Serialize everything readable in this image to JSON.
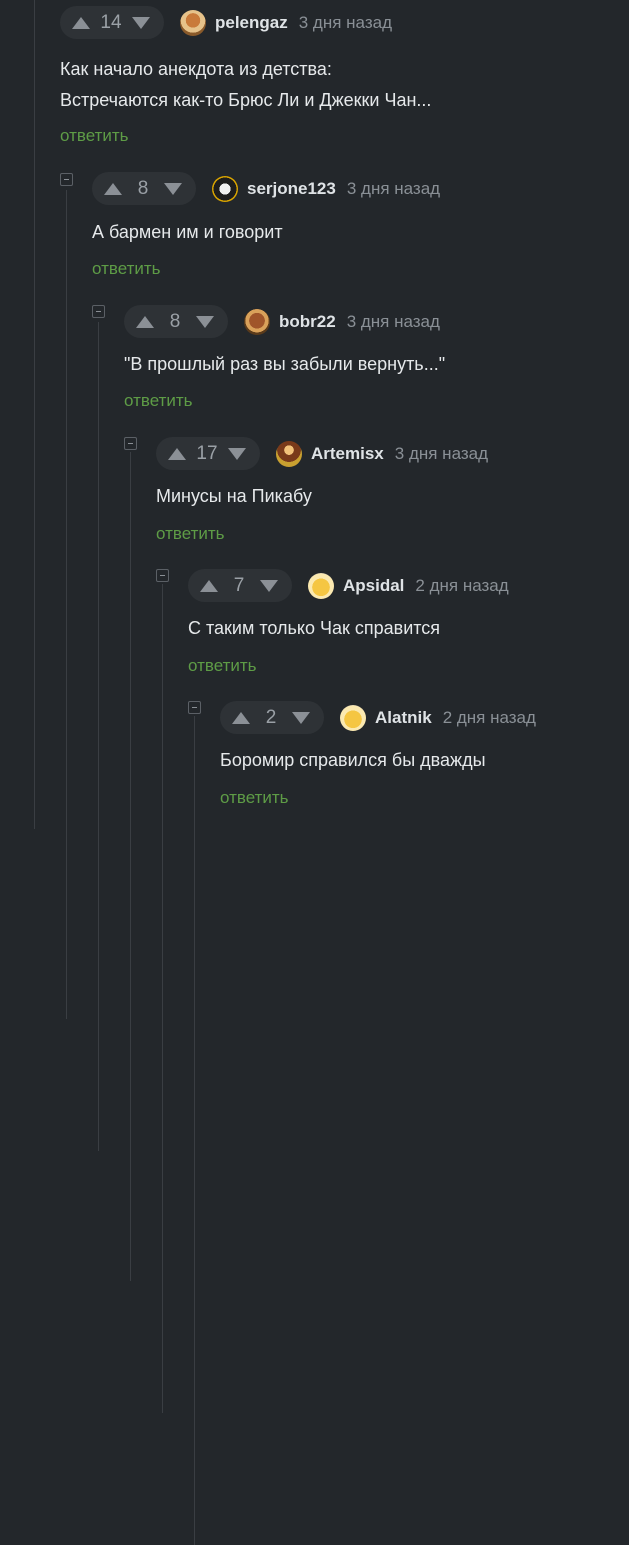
{
  "comments": [
    {
      "rating": "14",
      "author": "pelengaz",
      "time": "3 дня назад",
      "lines": [
        "Как начало анекдота из детства:",
        "Встречаются как-то Брюс Ли и Джекки Чан..."
      ],
      "reply": "ответить"
    },
    {
      "rating": "8",
      "author": "serjone123",
      "time": "3 дня назад",
      "lines": [
        "А бармен им и говорит"
      ],
      "reply": "ответить"
    },
    {
      "rating": "8",
      "author": "bobr22",
      "time": "3 дня назад",
      "lines": [
        "\"В прошлый раз вы забыли вернуть...\""
      ],
      "reply": "ответить"
    },
    {
      "rating": "17",
      "author": "Artemisx",
      "time": "3 дня назад",
      "lines": [
        "Минусы на Пикабу"
      ],
      "reply": "ответить"
    },
    {
      "rating": "7",
      "author": "Apsidal",
      "time": "2 дня назад",
      "lines": [
        "С таким только Чак справится"
      ],
      "reply": "ответить"
    },
    {
      "rating": "2",
      "author": "Alatnik",
      "time": "2 дня назад",
      "lines": [
        "Боромир справился бы дважды"
      ],
      "reply": "ответить"
    }
  ]
}
